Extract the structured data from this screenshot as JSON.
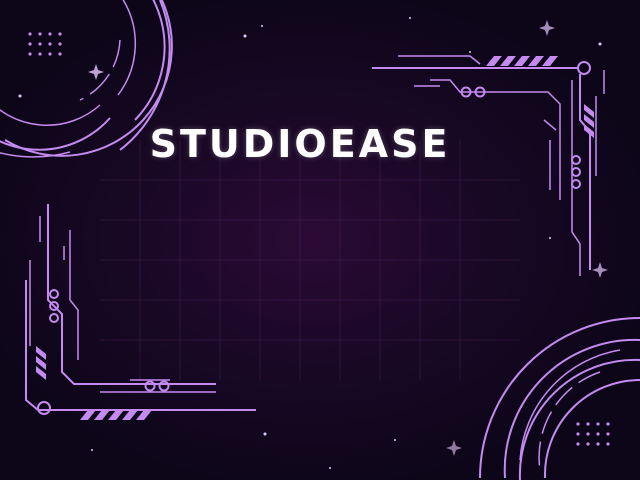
{
  "brand": {
    "name": "STUDIOEASE"
  },
  "theme": {
    "background": "#0c0618",
    "glow": "#2b0a35",
    "accent": "#c48af0",
    "text": "#ffffff"
  },
  "decorations": [
    "circuit-ring-icon",
    "circuit-trace-icon",
    "dot-matrix-icon",
    "sparkle-star-icon"
  ]
}
